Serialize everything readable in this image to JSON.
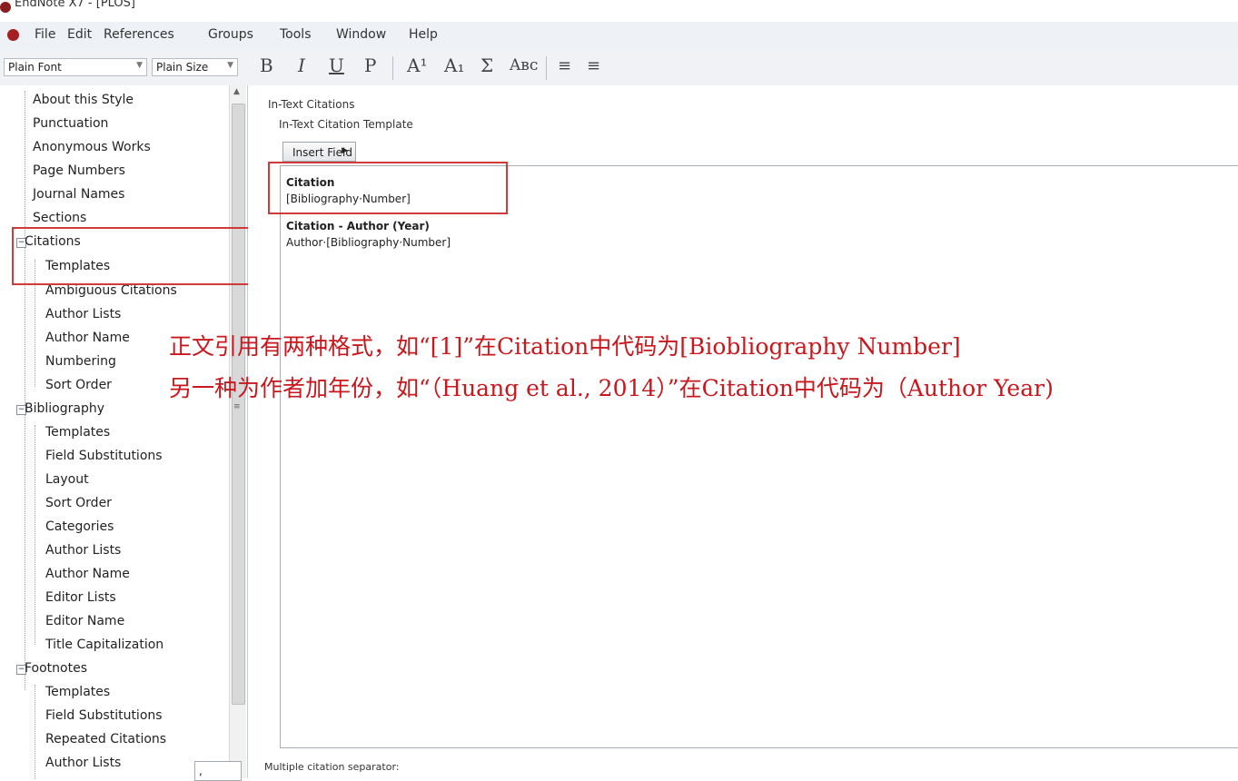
{
  "window": {
    "title": "EndNote X7 - [PLOS]"
  },
  "menu": [
    "File",
    "Edit",
    "References",
    "Groups",
    "Tools",
    "Window",
    "Help"
  ],
  "toolbar": {
    "font_value": "Plain Font",
    "size_value": "Plain Size",
    "buttons": [
      "B",
      "I",
      "U",
      "P",
      "A¹",
      "A₁",
      "Σ",
      "Aʙᴄ",
      "≡",
      "≡"
    ]
  },
  "tree": {
    "items": [
      "About this Style",
      "Punctuation",
      "Anonymous Works",
      "Page Numbers",
      "Journal Names",
      "Sections",
      "Citations",
      "Templates",
      "Ambiguous Citations",
      "Author Lists",
      "Author Name",
      "Numbering",
      "Sort Order",
      "Bibliography",
      "Templates",
      "Field Substitutions",
      "Layout",
      "Sort Order",
      "Categories",
      "Author Lists",
      "Author Name",
      "Editor Lists",
      "Editor Name",
      "Title Capitalization",
      "Footnotes",
      "Templates",
      "Field Substitutions",
      "Repeated Citations",
      "Author Lists"
    ]
  },
  "pane": {
    "heading": "In-Text Citations",
    "subheading": "In-Text Citation Template",
    "insert_field": "Insert Field",
    "citation_title": "Citation",
    "citation_code": "[Bibliography·Number]",
    "author_year_title": "Citation - Author (Year)",
    "author_year_code": "Author·[Bibliography·Number]",
    "separator_label": "Multiple citation separator:",
    "separator_value": ","
  },
  "annotations": {
    "line1": "正文引用有两种格式，如“[1]”在Citation中代码为[Biobliography Number]",
    "line2": "另一种为作者加年份，如“（Huang et al., 2014）”在Citation中代码为（Author Year)"
  },
  "colors": {
    "annotation_red": "#c8171d",
    "highlight_box": "#d13a3a"
  }
}
